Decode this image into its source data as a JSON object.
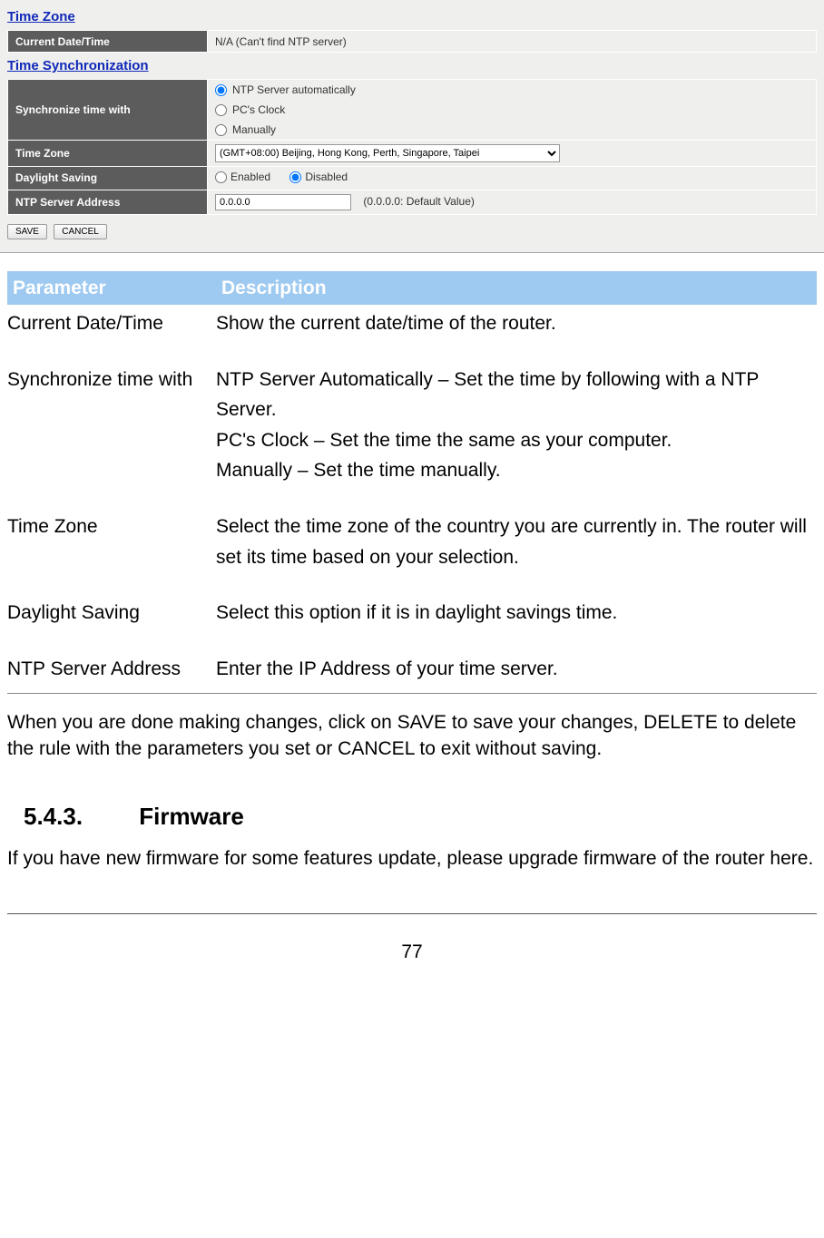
{
  "router": {
    "section1_title": "Time Zone",
    "current_label": "Current Date/Time",
    "current_value": "N/A (Can't find NTP server)",
    "section2_title": "Time  Synchronization",
    "sync_label": "Synchronize time with",
    "sync_opt_ntp": "NTP Server automatically",
    "sync_opt_pc": "PC's Clock",
    "sync_opt_manual": "Manually",
    "tz_label": "Time Zone",
    "tz_value": "(GMT+08:00) Beijing, Hong Kong, Perth, Singapore, Taipei",
    "ds_label": "Daylight Saving",
    "ds_enabled": "Enabled",
    "ds_disabled": "Disabled",
    "ntp_label": "NTP Server Address",
    "ntp_value": "0.0.0.0",
    "ntp_hint": "(0.0.0.0: Default Value)",
    "save_btn": "SAVE",
    "cancel_btn": "CANCEL"
  },
  "paramtable": {
    "head_param": "Parameter",
    "head_desc": "Description",
    "rows": [
      {
        "p": "Current Date/Time",
        "d": "Show the current date/time of the router."
      },
      {
        "p": "Synchronize time with",
        "d": "NTP Server Automatically – Set the time by following with a NTP Server.\nPC's Clock – Set the time the same as your computer.\nManually – Set the time manually."
      },
      {
        "p": "Time Zone",
        "d": "Select the time zone of the country you are currently in. The router will set its time based on your selection."
      },
      {
        "p": "Daylight Saving",
        "d": "Select this option if it is in daylight savings time."
      },
      {
        "p": "NTP Server Address",
        "d": "Enter the IP Address of your time server."
      }
    ]
  },
  "note": "When you are done making changes, click on SAVE to save your changes, DELETE to delete the rule with the parameters you set or CANCEL to exit without saving.",
  "section_number": "5.4.3.",
  "section_title": "Firmware",
  "section_text": "If you have new firmware for some features update, please upgrade firmware of the router here.",
  "page_number": "77"
}
